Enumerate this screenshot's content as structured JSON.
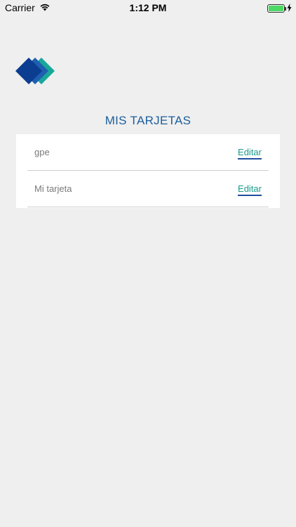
{
  "status_bar": {
    "carrier": "Carrier",
    "time": "1:12 PM",
    "wifi_icon": "wifi-icon",
    "battery_icon": "battery-icon",
    "charging_icon": "bolt-icon",
    "battery_level": 1.0
  },
  "logo": {
    "icon": "diamond-logo-icon",
    "colors": [
      "#0b3d91",
      "#1f5fb0",
      "#17a89a"
    ]
  },
  "title": "MIS TARJETAS",
  "cards": [
    {
      "name": "gpe",
      "edit_label": "Editar"
    },
    {
      "name": "Mi tarjeta",
      "edit_label": "Editar"
    }
  ],
  "colors": {
    "title": "#1b5e9c",
    "edit_text": "#1a9a8a",
    "edit_underline": "#1f4ea0",
    "background": "#efefef"
  }
}
